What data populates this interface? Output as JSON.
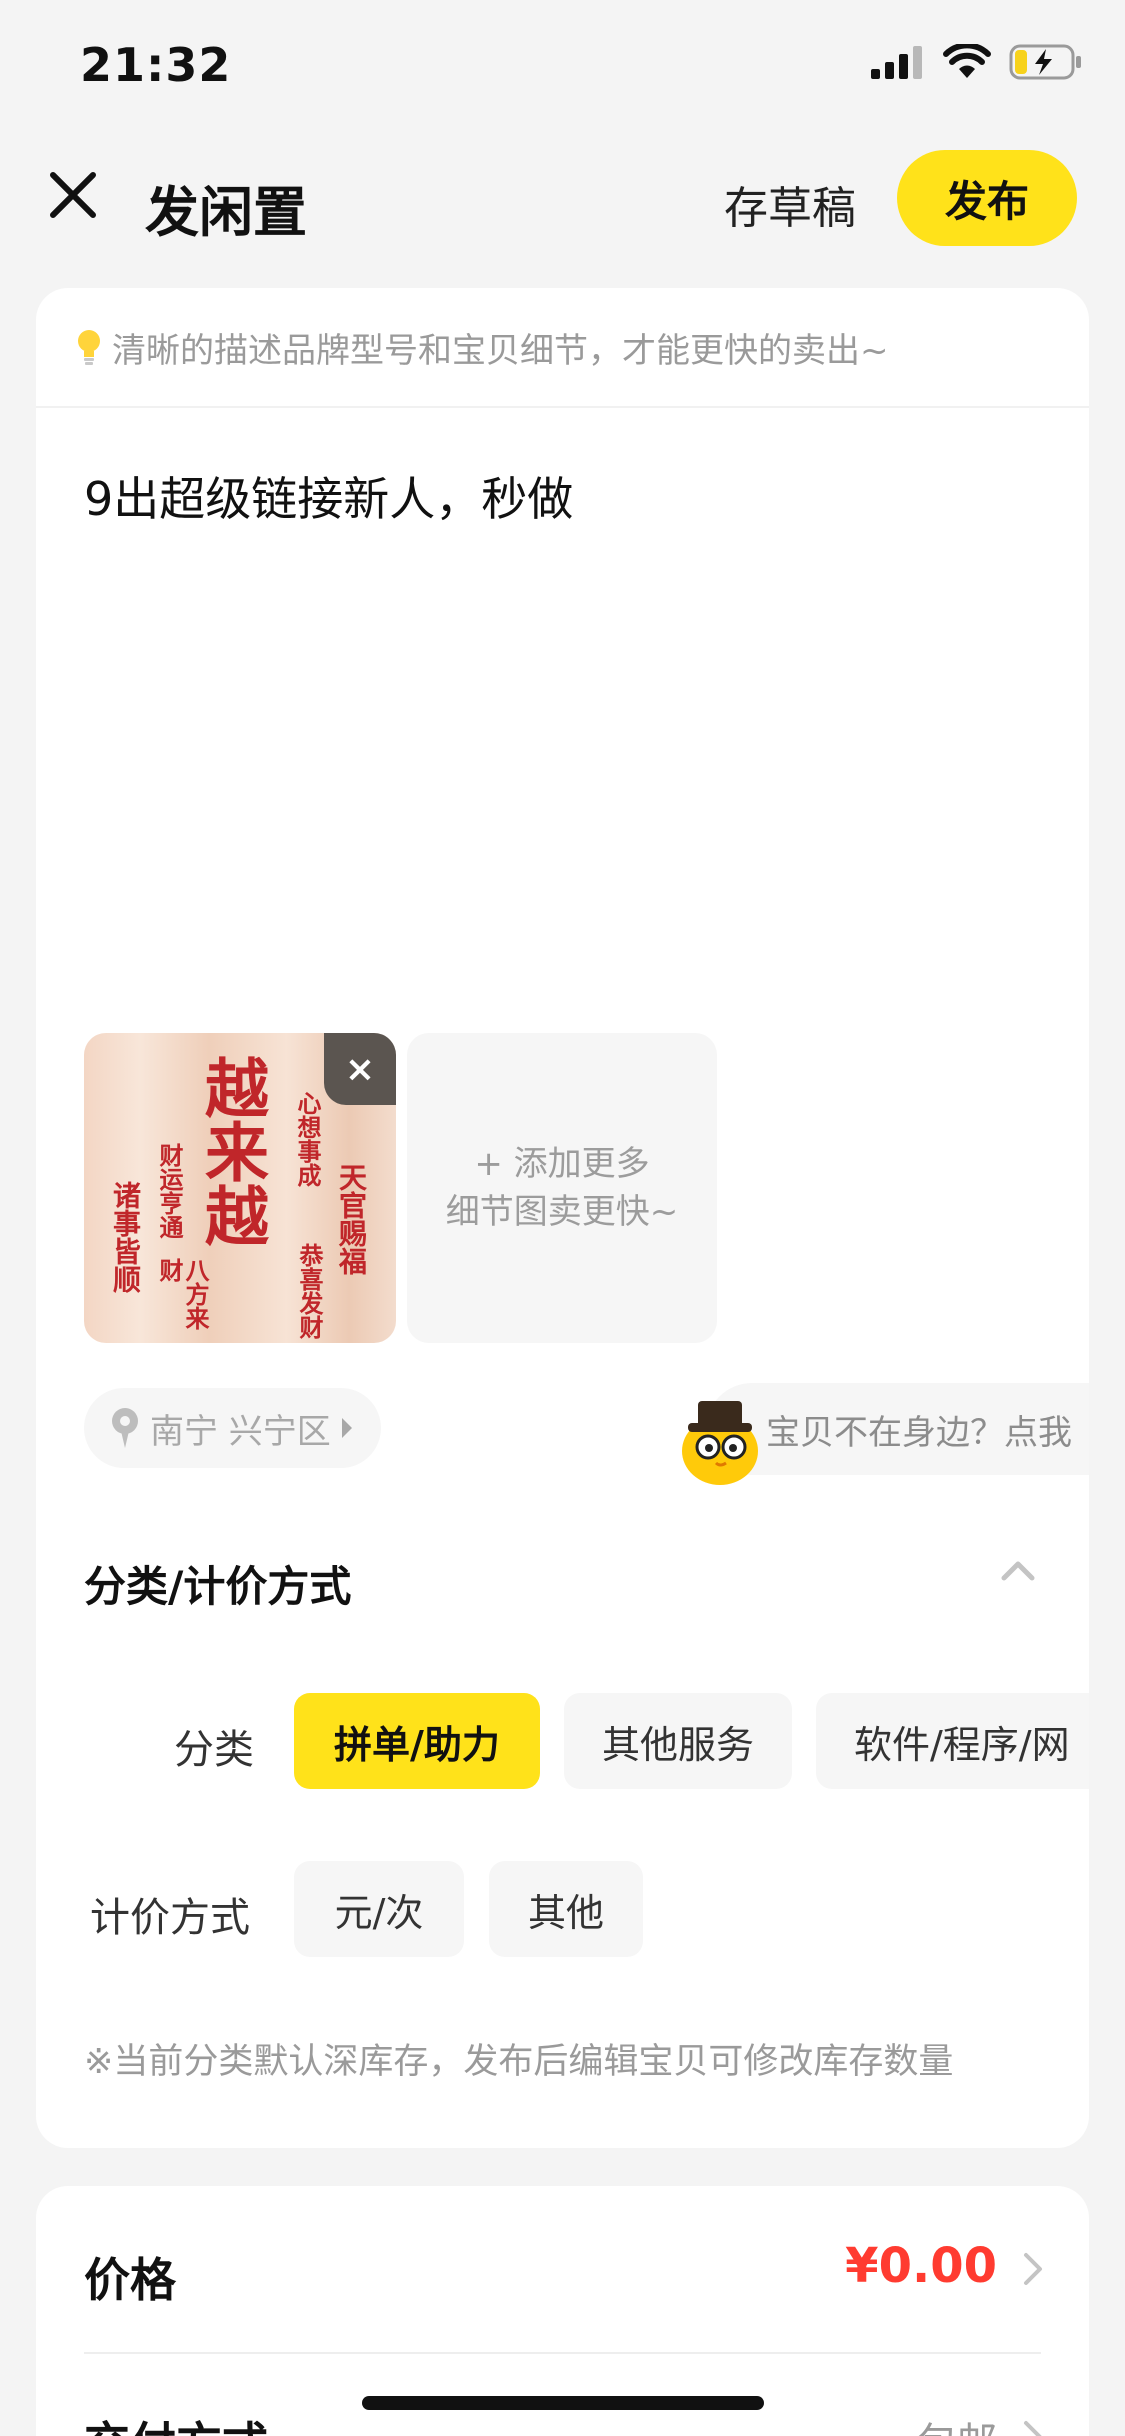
{
  "status_bar": {
    "time": "21:32"
  },
  "header": {
    "title": "发闲置",
    "draft_label": "存草稿",
    "publish_label": "发布"
  },
  "main": {
    "tip": "清晰的描述品牌型号和宝贝细节，才能更快的卖出~",
    "description": "9出超级链接新人，秒做",
    "photo": {
      "calligraphy": {
        "main": "越来越",
        "upper_right": "心想事成",
        "far_right": "天官赐福",
        "left": "财运亨通",
        "far_left": "诸事皆顺",
        "bottom": "八方来财",
        "bottom_right": "恭喜发财"
      },
      "delete_glyph": "×"
    },
    "add_photo": {
      "line1": "+ 添加更多",
      "line2": "细节图卖更快~"
    },
    "location": "南宁 兴宁区",
    "not_near": "宝贝不在身边？点我"
  },
  "category_section": {
    "title": "分类/计价方式",
    "category_label": "分类",
    "categories": [
      "拼单/助力",
      "其他服务",
      "软件/程序/网"
    ],
    "selected_category": 0,
    "pricing_label": "计价方式",
    "pricing_options": [
      "元/次",
      "其他"
    ],
    "note": "※当前分类默认深库存，发布后编辑宝贝可修改库存数量"
  },
  "price_section": {
    "price_label": "价格",
    "price_value": "¥0.00",
    "delivery_label": "交付方式",
    "delivery_value": "包邮"
  },
  "icons": {
    "close": "close-icon",
    "bulb": "bulb-icon",
    "location": "location-pin-icon",
    "chevron_up": "chevron-up-icon",
    "chevron_right": "chevron-right-icon"
  },
  "colors": {
    "accent": "#ffe21a",
    "price": "#ff3b30",
    "background": "#f4f4f4"
  }
}
